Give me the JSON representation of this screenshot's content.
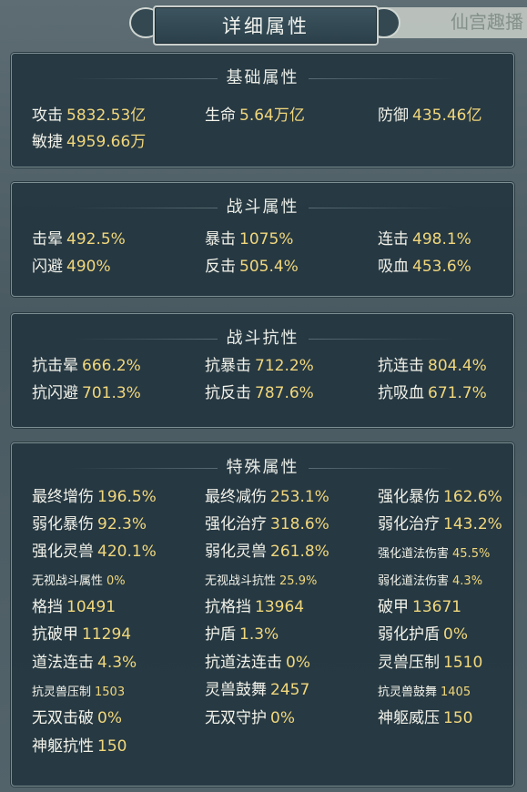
{
  "window": {
    "title": "详细属性",
    "corner_text": "仙宫趣播"
  },
  "colors": {
    "label": "#f2f2ea",
    "value": "#f1d77c",
    "panel": "#24363f"
  },
  "sections": [
    {
      "title": "基础属性",
      "rows": [
        [
          {
            "label": "攻击",
            "value": "5832.53亿"
          },
          {
            "label": "生命",
            "value": "5.64万亿"
          },
          {
            "label": "防御",
            "value": "435.46亿"
          }
        ],
        [
          {
            "label": "敏捷",
            "value": "4959.66万"
          }
        ]
      ]
    },
    {
      "title": "战斗属性",
      "rows": [
        [
          {
            "label": "击晕",
            "value": "492.5%"
          },
          {
            "label": "暴击",
            "value": "1075%"
          },
          {
            "label": "连击",
            "value": "498.1%"
          }
        ],
        [
          {
            "label": "闪避",
            "value": "490%"
          },
          {
            "label": "反击",
            "value": "505.4%"
          },
          {
            "label": "吸血",
            "value": "453.6%"
          }
        ]
      ]
    },
    {
      "title": "战斗抗性",
      "rows": [
        [
          {
            "label": "抗击晕",
            "value": "666.2%"
          },
          {
            "label": "抗暴击",
            "value": "712.2%"
          },
          {
            "label": "抗连击",
            "value": "804.4%"
          }
        ],
        [
          {
            "label": "抗闪避",
            "value": "701.3%"
          },
          {
            "label": "抗反击",
            "value": "787.6%"
          },
          {
            "label": "抗吸血",
            "value": "671.7%"
          }
        ]
      ]
    },
    {
      "title": "特殊属性",
      "rows": [
        [
          {
            "label": "最终增伤",
            "value": "196.5%"
          },
          {
            "label": "最终减伤",
            "value": "253.1%"
          },
          {
            "label": "强化暴伤",
            "value": "162.6%"
          }
        ],
        [
          {
            "label": "弱化暴伤",
            "value": "92.3%"
          },
          {
            "label": "强化治疗",
            "value": "318.6%"
          },
          {
            "label": "弱化治疗",
            "value": "143.2%"
          }
        ],
        [
          {
            "label": "强化灵兽",
            "value": "420.1%"
          },
          {
            "label": "弱化灵兽",
            "value": "261.8%"
          },
          {
            "label": "强化道法伤害",
            "value": "45.5%",
            "small": true
          }
        ],
        [
          {
            "label": "无视战斗属性",
            "value": "0%",
            "small": true
          },
          {
            "label": "无视战斗抗性",
            "value": "25.9%",
            "small": true
          },
          {
            "label": "弱化道法伤害",
            "value": "4.3%",
            "small": true
          }
        ],
        [
          {
            "label": "格挡",
            "value": "10491"
          },
          {
            "label": "抗格挡",
            "value": "13964"
          },
          {
            "label": "破甲",
            "value": "13671"
          }
        ],
        [
          {
            "label": "抗破甲",
            "value": "11294"
          },
          {
            "label": "护盾",
            "value": "1.3%"
          },
          {
            "label": "弱化护盾",
            "value": "0%"
          }
        ],
        [
          {
            "label": "道法连击",
            "value": "4.3%"
          },
          {
            "label": "抗道法连击",
            "value": "0%"
          },
          {
            "label": "灵兽压制",
            "value": "1510"
          }
        ],
        [
          {
            "label": "抗灵兽压制",
            "value": "1503",
            "small": true
          },
          {
            "label": "灵兽鼓舞",
            "value": "2457"
          },
          {
            "label": "抗灵兽鼓舞",
            "value": "1405",
            "small": true
          }
        ],
        [
          {
            "label": "无双击破",
            "value": "0%"
          },
          {
            "label": "无双守护",
            "value": "0%"
          },
          {
            "label": "神躯威压",
            "value": "150"
          }
        ],
        [
          {
            "label": "神躯抗性",
            "value": "150"
          }
        ]
      ]
    }
  ]
}
